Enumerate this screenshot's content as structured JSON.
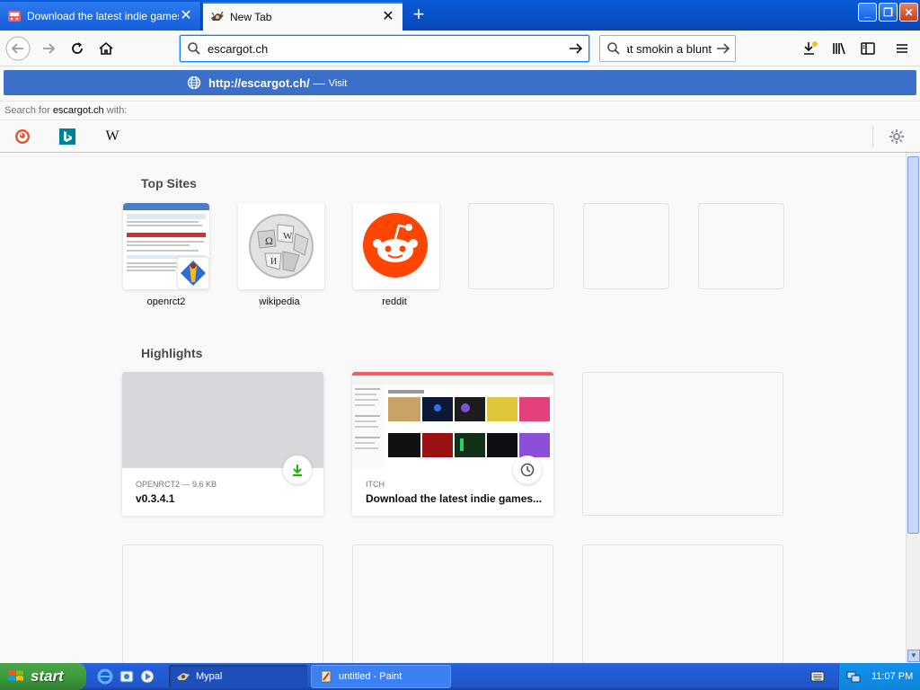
{
  "tabs": [
    {
      "label": "Download the latest indie games",
      "active": false,
      "close": "✕"
    },
    {
      "label": "New Tab",
      "active": true,
      "close": "✕"
    }
  ],
  "newtab_glyph": "+",
  "window_buttons": {
    "minimize": "_",
    "restore": "❐",
    "close": "✕"
  },
  "urlbar": {
    "value": "escargot.ch",
    "icon": "search-icon",
    "go": "arrow-right-icon"
  },
  "searchbar": {
    "value": "hat smokin a blunt",
    "icon": "search-icon"
  },
  "suggestion": {
    "url": "http://escargot.ch/",
    "separator": "—",
    "action": "Visit"
  },
  "search_for": {
    "prefix": "Search for",
    "term": "escargot.ch",
    "suffix": "with:"
  },
  "engines": [
    {
      "name": "DuckDuckGo",
      "icon": "duckduckgo-icon"
    },
    {
      "name": "Bing",
      "icon": "bing-icon"
    },
    {
      "name": "Wikipedia",
      "icon": "wikipedia-icon",
      "glyph": "W"
    }
  ],
  "top_sites": {
    "title": "Top Sites",
    "items": [
      {
        "label": "openrct2"
      },
      {
        "label": "wikipedia"
      },
      {
        "label": "reddit"
      },
      {
        "label": ""
      },
      {
        "label": ""
      },
      {
        "label": ""
      }
    ]
  },
  "highlights": {
    "title": "Highlights",
    "cards": [
      {
        "context": "OPENRCT2 — 9.6 KB",
        "title": "v0.3.4.1",
        "badge": "download-icon"
      },
      {
        "context": "ITCH",
        "title": "Download the latest indie games...",
        "badge": "clock-icon"
      }
    ]
  },
  "taskbar": {
    "start": "start",
    "tasks": [
      {
        "label": "Mypal",
        "active": true
      },
      {
        "label": "untitled - Paint",
        "active": false
      }
    ],
    "clock": "11:07 PM"
  },
  "colors": {
    "accent": "#0a84ff",
    "visit_row": "#3c6fc9",
    "reddit": "#ff4500",
    "xp_blue": "#245edb",
    "start_green": "#3c9c3c"
  }
}
